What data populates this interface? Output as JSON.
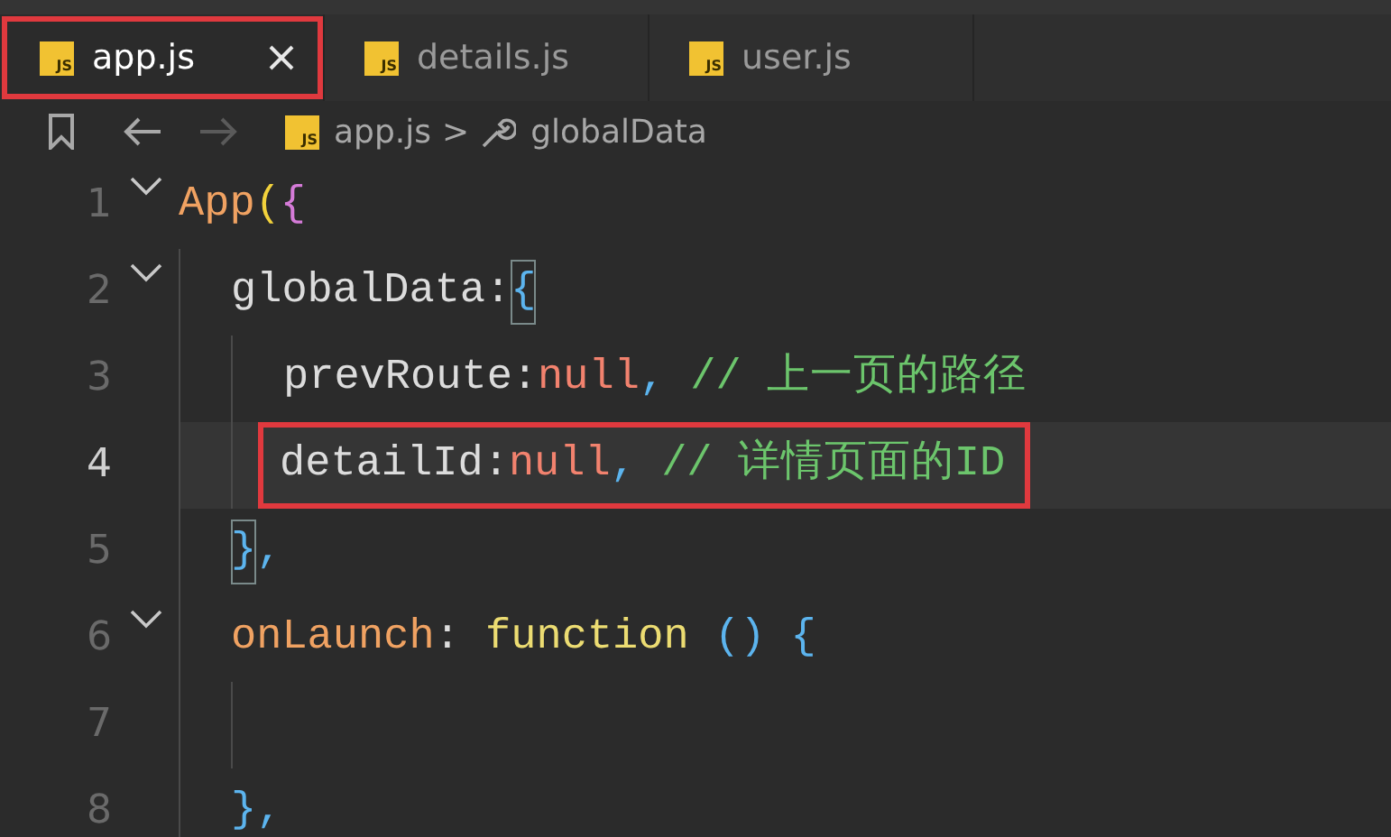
{
  "tabs": [
    {
      "icon": "JS",
      "label": "app.js",
      "selected": true,
      "annotated": true
    },
    {
      "icon": "JS",
      "label": "details.js",
      "selected": false,
      "annotated": false
    },
    {
      "icon": "JS",
      "label": "user.js",
      "selected": false,
      "annotated": false
    }
  ],
  "breadcrumb": {
    "file_icon": "JS",
    "file": "app.js",
    "separator": ">",
    "symbol": "globalData"
  },
  "lines": [
    {
      "number": "1",
      "foldable": true,
      "current": false,
      "annotated": false,
      "tokens": [
        {
          "text": "App",
          "kind": "fn"
        },
        {
          "text": "(",
          "kind": "paren"
        },
        {
          "text": "{",
          "kind": "brace2"
        }
      ],
      "children": [
        {
          "number": "2",
          "foldable": true,
          "current": false,
          "annotated": false,
          "tokens": [
            {
              "text": "globalData",
              "kind": "prop"
            },
            {
              "text": ":",
              "kind": "punct"
            },
            {
              "text": "{",
              "kind": "brace",
              "matched": true
            }
          ],
          "children": [
            {
              "number": "3",
              "foldable": false,
              "current": false,
              "annotated": false,
              "tokens": [
                {
                  "text": "prevRoute",
                  "kind": "prop"
                },
                {
                  "text": ":",
                  "kind": "punct"
                },
                {
                  "text": "null",
                  "kind": "nul"
                },
                {
                  "text": ",",
                  "kind": "sep"
                },
                {
                  "text": " // 上一页的路径",
                  "kind": "comment"
                }
              ]
            },
            {
              "number": "4",
              "foldable": false,
              "current": true,
              "annotated": true,
              "tokens": [
                {
                  "text": "detailId",
                  "kind": "prop"
                },
                {
                  "text": ":",
                  "kind": "punct"
                },
                {
                  "text": "null",
                  "kind": "nul"
                },
                {
                  "text": ",",
                  "kind": "sep"
                },
                {
                  "text": " // 详情页面的ID",
                  "kind": "comment"
                }
              ]
            }
          ]
        },
        {
          "number": "5",
          "foldable": false,
          "current": false,
          "annotated": false,
          "tokens": [
            {
              "text": "}",
              "kind": "brace",
              "matched": true
            },
            {
              "text": ",",
              "kind": "sep"
            }
          ]
        },
        {
          "number": "6",
          "foldable": true,
          "current": false,
          "annotated": false,
          "tokens": [
            {
              "text": "onLaunch",
              "kind": "fn"
            },
            {
              "text": ":",
              "kind": "punct"
            },
            {
              "text": " function",
              "kind": "keyword"
            },
            {
              "text": " ()",
              "kind": "brace"
            },
            {
              "text": " {",
              "kind": "brace"
            }
          ],
          "children": [
            {
              "number": "7",
              "foldable": false,
              "current": false,
              "annotated": false
            }
          ]
        },
        {
          "number": "8",
          "foldable": false,
          "current": false,
          "annotated": false,
          "tokens": [
            {
              "text": "}",
              "kind": "brace"
            },
            {
              "text": ",",
              "kind": "sep"
            }
          ]
        }
      ]
    }
  ]
}
